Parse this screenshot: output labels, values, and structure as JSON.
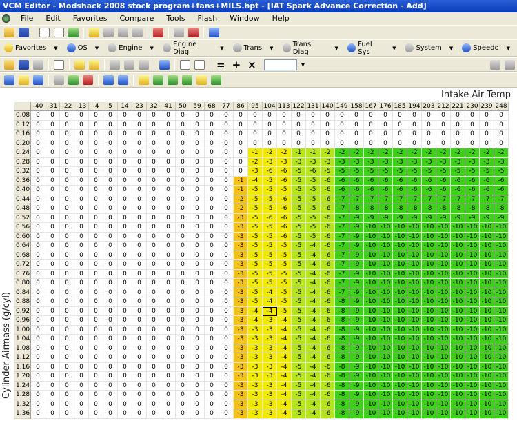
{
  "window": {
    "title": "VCM Editor - Modshack 2008 stock program+fans+MILS.hpt - [IAT Spark Advance Correction - Add]"
  },
  "menu": [
    "File",
    "Edit",
    "Favorites",
    "Compare",
    "Tools",
    "Flash",
    "Window",
    "Help"
  ],
  "nav_toolbar": [
    "Favorites",
    "OS",
    "Engine",
    "Engine Diag",
    "Trans",
    "Trans Diag",
    "Fuel Sys",
    "System",
    "Speedo"
  ],
  "edit_toolbar": {
    "ops": [
      "=",
      "+",
      "×"
    ],
    "value": ""
  },
  "table": {
    "x_axis_title": "Intake Air Temp",
    "y_axis_title": "Cylinder Airmass (g/cyl)",
    "columns": [
      "-40",
      "-31",
      "-22",
      "-13",
      "-4",
      "5",
      "14",
      "23",
      "32",
      "41",
      "50",
      "59",
      "68",
      "77",
      "86",
      "95",
      "104",
      "113",
      "122",
      "131",
      "140",
      "149",
      "158",
      "167",
      "176",
      "185",
      "194",
      "203",
      "212",
      "221",
      "230",
      "239",
      "248"
    ],
    "rows": [
      "0.08",
      "0.12",
      "0.16",
      "0.20",
      "0.24",
      "0.28",
      "0.32",
      "0.36",
      "0.40",
      "0.44",
      "0.48",
      "0.52",
      "0.56",
      "0.60",
      "0.64",
      "0.68",
      "0.72",
      "0.76",
      "0.80",
      "0.84",
      "0.88",
      "0.92",
      "0.96",
      "1.00",
      "1.04",
      "1.08",
      "1.12",
      "1.16",
      "1.20",
      "1.24",
      "1.28",
      "1.32",
      "1.36"
    ],
    "values": [
      [
        0,
        0,
        0,
        0,
        0,
        0,
        0,
        0,
        0,
        0,
        0,
        0,
        0,
        0,
        0,
        0,
        0,
        0,
        0,
        0,
        0,
        0,
        0,
        0,
        0,
        0,
        0,
        0,
        0,
        0,
        0,
        0,
        0
      ],
      [
        0,
        0,
        0,
        0,
        0,
        0,
        0,
        0,
        0,
        0,
        0,
        0,
        0,
        0,
        0,
        0,
        0,
        0,
        0,
        0,
        0,
        0,
        0,
        0,
        0,
        0,
        0,
        0,
        0,
        0,
        0,
        0,
        0
      ],
      [
        0,
        0,
        0,
        0,
        0,
        0,
        0,
        0,
        0,
        0,
        0,
        0,
        0,
        0,
        0,
        0,
        0,
        0,
        0,
        0,
        0,
        0,
        0,
        0,
        0,
        0,
        0,
        0,
        0,
        0,
        0,
        0,
        0
      ],
      [
        0,
        0,
        0,
        0,
        0,
        0,
        0,
        0,
        0,
        0,
        0,
        0,
        0,
        0,
        0,
        0,
        0,
        0,
        0,
        0,
        0,
        0,
        0,
        0,
        0,
        0,
        0,
        0,
        0,
        0,
        0,
        0,
        0
      ],
      [
        0,
        0,
        0,
        0,
        0,
        0,
        0,
        0,
        0,
        0,
        0,
        0,
        0,
        0,
        0,
        -1,
        -2,
        -2,
        -1,
        -1,
        -2,
        -2,
        -2,
        -2,
        -2,
        -2,
        -2,
        -2,
        -2,
        -2,
        -2,
        -2,
        -2
      ],
      [
        0,
        0,
        0,
        0,
        0,
        0,
        0,
        0,
        0,
        0,
        0,
        0,
        0,
        0,
        0,
        -2,
        -3,
        -3,
        -3,
        -3,
        -3,
        -3,
        -3,
        -3,
        -3,
        -3,
        -3,
        -3,
        -3,
        -3,
        -3,
        -3,
        -3
      ],
      [
        0,
        0,
        0,
        0,
        0,
        0,
        0,
        0,
        0,
        0,
        0,
        0,
        0,
        0,
        0,
        -3,
        -6,
        -6,
        -5,
        -6,
        -5,
        -5,
        -5,
        -5,
        -5,
        -5,
        -5,
        -5,
        -5,
        -5,
        -5,
        -5,
        -5
      ],
      [
        0,
        0,
        0,
        0,
        0,
        0,
        0,
        0,
        0,
        0,
        0,
        0,
        0,
        0,
        -1,
        -4,
        -5,
        -6,
        -5,
        -5,
        -6,
        -6,
        -6,
        -6,
        -6,
        -6,
        -6,
        -6,
        -6,
        -6,
        -6,
        -6,
        -6
      ],
      [
        0,
        0,
        0,
        0,
        0,
        0,
        0,
        0,
        0,
        0,
        0,
        0,
        0,
        0,
        -1,
        -5,
        -5,
        -5,
        -5,
        -5,
        -6,
        -6,
        -6,
        -6,
        -6,
        -6,
        -6,
        -6,
        -6,
        -6,
        -6,
        -6,
        -6
      ],
      [
        0,
        0,
        0,
        0,
        0,
        0,
        0,
        0,
        0,
        0,
        0,
        0,
        0,
        0,
        -2,
        -5,
        -5,
        -6,
        -5,
        -5,
        -6,
        -7,
        -7,
        -7,
        -7,
        -7,
        -7,
        -7,
        -7,
        -7,
        -7,
        -7,
        -7
      ],
      [
        0,
        0,
        0,
        0,
        0,
        0,
        0,
        0,
        0,
        0,
        0,
        0,
        0,
        0,
        -2,
        -5,
        -5,
        -6,
        -5,
        -5,
        -6,
        -7,
        -8,
        -8,
        -8,
        -8,
        -8,
        -8,
        -8,
        -8,
        -8,
        -8,
        -8
      ],
      [
        0,
        0,
        0,
        0,
        0,
        0,
        0,
        0,
        0,
        0,
        0,
        0,
        0,
        0,
        -3,
        -5,
        -6,
        -6,
        -5,
        -5,
        -6,
        -7,
        -9,
        -9,
        -9,
        -9,
        -9,
        -9,
        -9,
        -9,
        -9,
        -9,
        -9
      ],
      [
        0,
        0,
        0,
        0,
        0,
        0,
        0,
        0,
        0,
        0,
        0,
        0,
        0,
        0,
        -3,
        -5,
        -5,
        -6,
        -5,
        -5,
        -6,
        -7,
        -9,
        -10,
        -10,
        -10,
        -10,
        -10,
        -10,
        -10,
        -10,
        -10,
        -10
      ],
      [
        0,
        0,
        0,
        0,
        0,
        0,
        0,
        0,
        0,
        0,
        0,
        0,
        0,
        0,
        -3,
        -5,
        -5,
        -6,
        -5,
        -5,
        -6,
        -7,
        -9,
        -10,
        -10,
        -10,
        -10,
        -10,
        -10,
        -10,
        -10,
        -10,
        -10
      ],
      [
        0,
        0,
        0,
        0,
        0,
        0,
        0,
        0,
        0,
        0,
        0,
        0,
        0,
        0,
        -3,
        -5,
        -5,
        -5,
        -5,
        -4,
        -6,
        -7,
        -9,
        -10,
        -10,
        -10,
        -10,
        -10,
        -10,
        -10,
        -10,
        -10,
        -10
      ],
      [
        0,
        0,
        0,
        0,
        0,
        0,
        0,
        0,
        0,
        0,
        0,
        0,
        0,
        0,
        -3,
        -5,
        -5,
        -5,
        -5,
        -4,
        -6,
        -7,
        -9,
        -10,
        -10,
        -10,
        -10,
        -10,
        -10,
        -10,
        -10,
        -10,
        -10
      ],
      [
        0,
        0,
        0,
        0,
        0,
        0,
        0,
        0,
        0,
        0,
        0,
        0,
        0,
        0,
        -3,
        -5,
        -5,
        -5,
        -5,
        -4,
        -6,
        -7,
        -9,
        -10,
        -10,
        -10,
        -10,
        -10,
        -10,
        -10,
        -10,
        -10,
        -10
      ],
      [
        0,
        0,
        0,
        0,
        0,
        0,
        0,
        0,
        0,
        0,
        0,
        0,
        0,
        0,
        -3,
        -5,
        -5,
        -5,
        -5,
        -4,
        -6,
        -7,
        -9,
        -10,
        -10,
        -10,
        -10,
        -10,
        -10,
        -10,
        -10,
        -10,
        -10
      ],
      [
        0,
        0,
        0,
        0,
        0,
        0,
        0,
        0,
        0,
        0,
        0,
        0,
        0,
        0,
        -3,
        -5,
        -5,
        -5,
        -5,
        -4,
        -6,
        -7,
        -9,
        -10,
        -10,
        -10,
        -10,
        -10,
        -10,
        -10,
        -10,
        -10,
        -10
      ],
      [
        0,
        0,
        0,
        0,
        0,
        0,
        0,
        0,
        0,
        0,
        0,
        0,
        0,
        0,
        -3,
        -5,
        -4,
        -5,
        -5,
        -4,
        -6,
        -7,
        -9,
        -10,
        -10,
        -10,
        -10,
        -10,
        -10,
        -10,
        -10,
        -10,
        -10
      ],
      [
        0,
        0,
        0,
        0,
        0,
        0,
        0,
        0,
        0,
        0,
        0,
        0,
        0,
        0,
        -3,
        -5,
        -4,
        -5,
        -5,
        -4,
        -6,
        -8,
        -9,
        -10,
        -10,
        -10,
        -10,
        -10,
        -10,
        -10,
        -10,
        -10,
        -10
      ],
      [
        0,
        0,
        0,
        0,
        0,
        0,
        0,
        0,
        0,
        0,
        0,
        0,
        0,
        0,
        -3,
        -4,
        -4,
        -5,
        -5,
        -4,
        -6,
        -8,
        -9,
        -10,
        -10,
        -10,
        -10,
        -10,
        -10,
        -10,
        -10,
        -10,
        -10
      ],
      [
        0,
        0,
        0,
        0,
        0,
        0,
        0,
        0,
        0,
        0,
        0,
        0,
        0,
        0,
        -3,
        -4,
        -3,
        -4,
        -5,
        -4,
        -6,
        -8,
        -9,
        -10,
        -10,
        -10,
        -10,
        -10,
        -10,
        -10,
        -10,
        -10,
        -10
      ],
      [
        0,
        0,
        0,
        0,
        0,
        0,
        0,
        0,
        0,
        0,
        0,
        0,
        0,
        0,
        -3,
        -3,
        -3,
        -4,
        -5,
        -4,
        -6,
        -8,
        -9,
        -10,
        -10,
        -10,
        -10,
        -10,
        -10,
        -10,
        -10,
        -10,
        -10
      ],
      [
        0,
        0,
        0,
        0,
        0,
        0,
        0,
        0,
        0,
        0,
        0,
        0,
        0,
        0,
        -3,
        -3,
        -3,
        -4,
        -5,
        -4,
        -6,
        -8,
        -9,
        -10,
        -10,
        -10,
        -10,
        -10,
        -10,
        -10,
        -10,
        -10,
        -10
      ],
      [
        0,
        0,
        0,
        0,
        0,
        0,
        0,
        0,
        0,
        0,
        0,
        0,
        0,
        0,
        -3,
        -3,
        -3,
        -4,
        -5,
        -4,
        -6,
        -8,
        -9,
        -10,
        -10,
        -10,
        -10,
        -10,
        -10,
        -10,
        -10,
        -10,
        -10
      ],
      [
        0,
        0,
        0,
        0,
        0,
        0,
        0,
        0,
        0,
        0,
        0,
        0,
        0,
        0,
        -3,
        -3,
        -3,
        -4,
        -5,
        -4,
        -6,
        -8,
        -9,
        -10,
        -10,
        -10,
        -10,
        -10,
        -10,
        -10,
        -10,
        -10,
        -10
      ],
      [
        0,
        0,
        0,
        0,
        0,
        0,
        0,
        0,
        0,
        0,
        0,
        0,
        0,
        0,
        -3,
        -3,
        -3,
        -4,
        -5,
        -4,
        -6,
        -8,
        -9,
        -10,
        -10,
        -10,
        -10,
        -10,
        -10,
        -10,
        -10,
        -10,
        -10
      ],
      [
        0,
        0,
        0,
        0,
        0,
        0,
        0,
        0,
        0,
        0,
        0,
        0,
        0,
        0,
        -3,
        -3,
        -3,
        -4,
        -5,
        -4,
        -6,
        -8,
        -9,
        -10,
        -10,
        -10,
        -10,
        -10,
        -10,
        -10,
        -10,
        -10,
        -10
      ],
      [
        0,
        0,
        0,
        0,
        0,
        0,
        0,
        0,
        0,
        0,
        0,
        0,
        0,
        0,
        -3,
        -3,
        -3,
        -4,
        -5,
        -4,
        -6,
        -8,
        -9,
        -10,
        -10,
        -10,
        -10,
        -10,
        -10,
        -10,
        -10,
        -10,
        -10
      ],
      [
        0,
        0,
        0,
        0,
        0,
        0,
        0,
        0,
        0,
        0,
        0,
        0,
        0,
        0,
        -3,
        -3,
        -3,
        -4,
        -5,
        -4,
        -6,
        -8,
        -9,
        -10,
        -10,
        -10,
        -10,
        -10,
        -10,
        -10,
        -10,
        -10,
        -10
      ],
      [
        0,
        0,
        0,
        0,
        0,
        0,
        0,
        0,
        0,
        0,
        0,
        0,
        0,
        0,
        -3,
        -3,
        -3,
        -4,
        -5,
        -4,
        -6,
        -8,
        -9,
        -10,
        -10,
        -10,
        -10,
        -10,
        -10,
        -10,
        -10,
        -10,
        -10
      ],
      [
        0,
        0,
        0,
        0,
        0,
        0,
        0,
        0,
        0,
        0,
        0,
        0,
        0,
        0,
        -3,
        -3,
        -3,
        -4,
        -5,
        -4,
        -6,
        -8,
        -9,
        -10,
        -10,
        -10,
        -10,
        -10,
        -10,
        -10,
        -10,
        -10,
        -10
      ]
    ],
    "selected_cell": {
      "row": 21,
      "col": 16
    },
    "colors": {
      "zero": "#ffffff",
      "yellow": "#f2ea00",
      "orange": "#f5c21a",
      "light_green": "#b6e51c",
      "green": "#3fd11a"
    }
  }
}
